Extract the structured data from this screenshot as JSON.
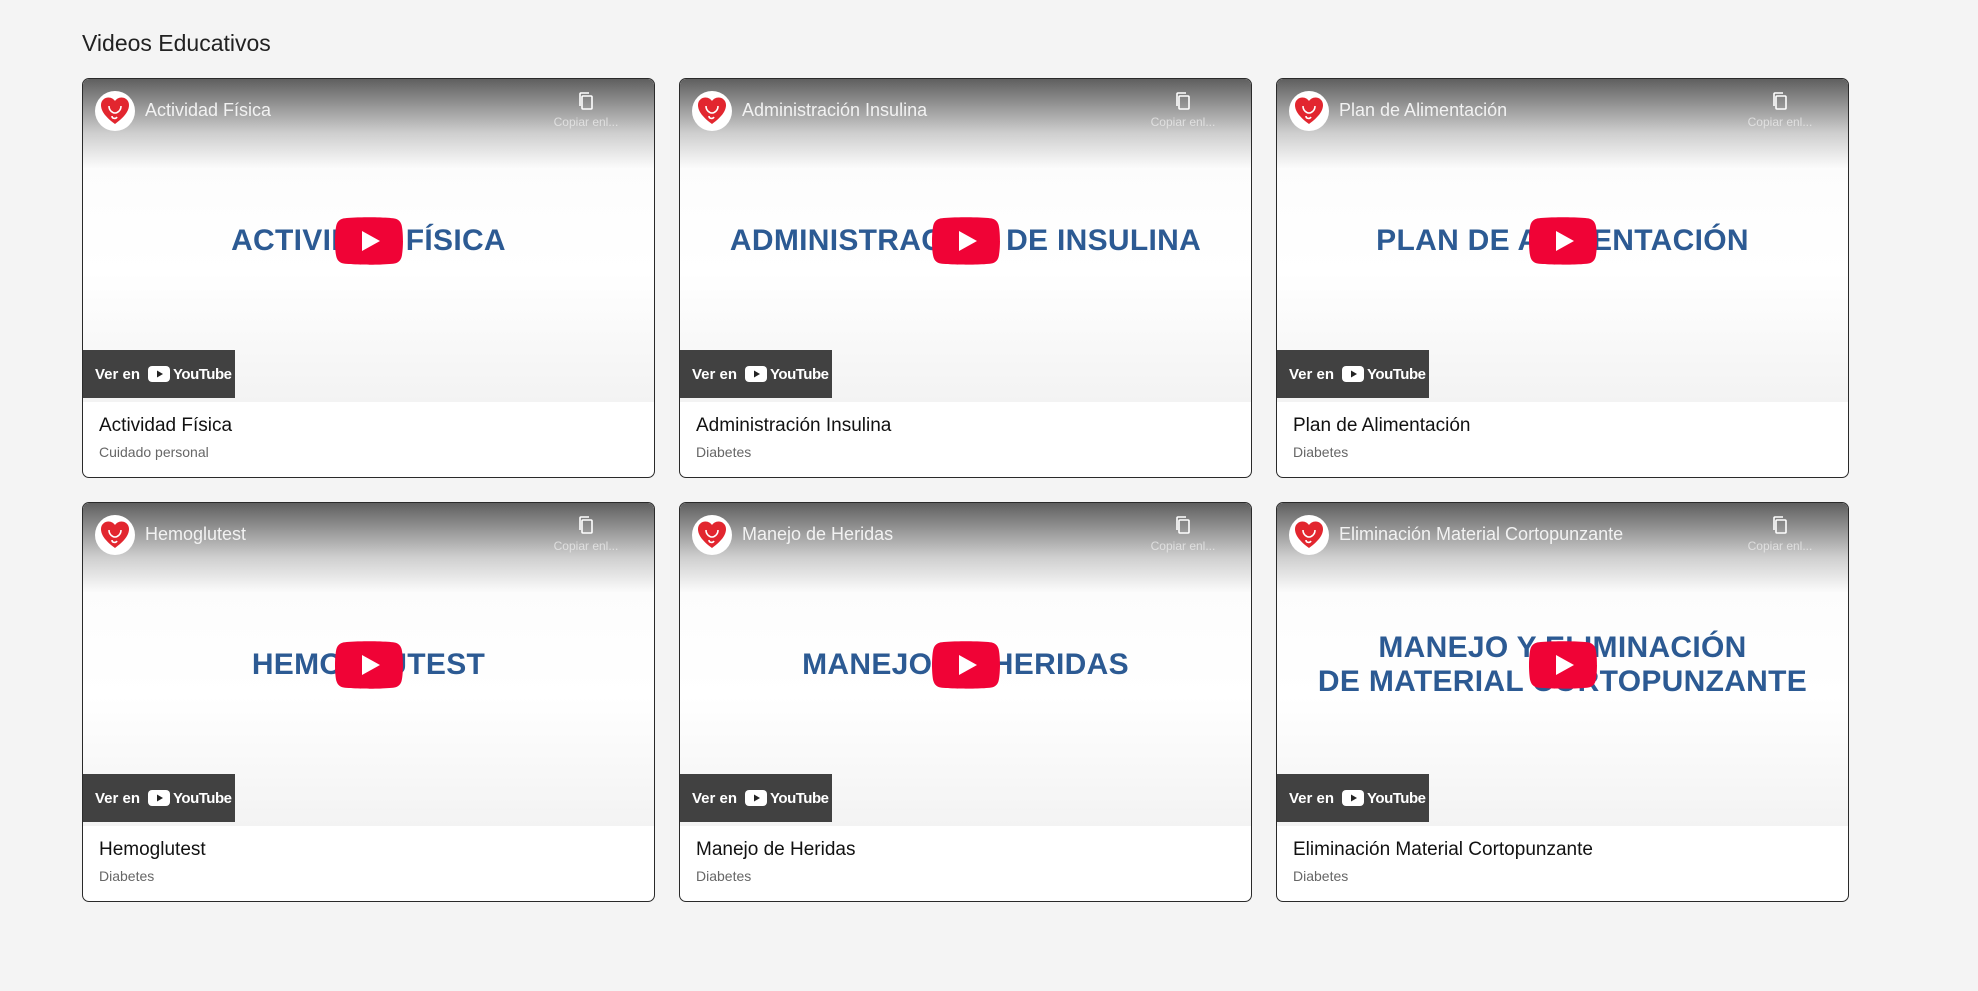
{
  "section": {
    "title": "Videos Educativos"
  },
  "colors": {
    "background": "#f4f4f4",
    "thumb_text": "#2c5a93",
    "play_red": "#f00336",
    "logo_red": "#e2262f"
  },
  "player": {
    "copy_link_label": "Copiar enl...",
    "watch_on_label": "Ver en",
    "youtube_label": "YouTube"
  },
  "videos": [
    {
      "video_title": "Actividad Física",
      "thumb_text": "ACTIVIDAD FÍSICA",
      "title": "Actividad Física",
      "category": "Cuidado personal"
    },
    {
      "video_title": "Administración Insulina",
      "thumb_text": "ADMINISTRACIÓN DE INSULINA",
      "title": "Administración Insulina",
      "category": "Diabetes"
    },
    {
      "video_title": "Plan de Alimentación",
      "thumb_text": "PLAN DE ALIMENTACIÓN",
      "title": "Plan de Alimentación",
      "category": "Diabetes"
    },
    {
      "video_title": "Hemoglutest",
      "thumb_text": "HEMOGLUTEST",
      "title": "Hemoglutest",
      "category": "Diabetes"
    },
    {
      "video_title": "Manejo de Heridas",
      "thumb_text": "MANEJO DE HERIDAS",
      "title": "Manejo de Heridas",
      "category": "Diabetes"
    },
    {
      "video_title": "Eliminación Material Cortopunzante",
      "thumb_text": "MANEJO Y ELIMINACIÓN\nDE MATERIAL CORTOPUNZANTE",
      "title": "Eliminación Material Cortopunzante",
      "category": "Diabetes"
    }
  ]
}
